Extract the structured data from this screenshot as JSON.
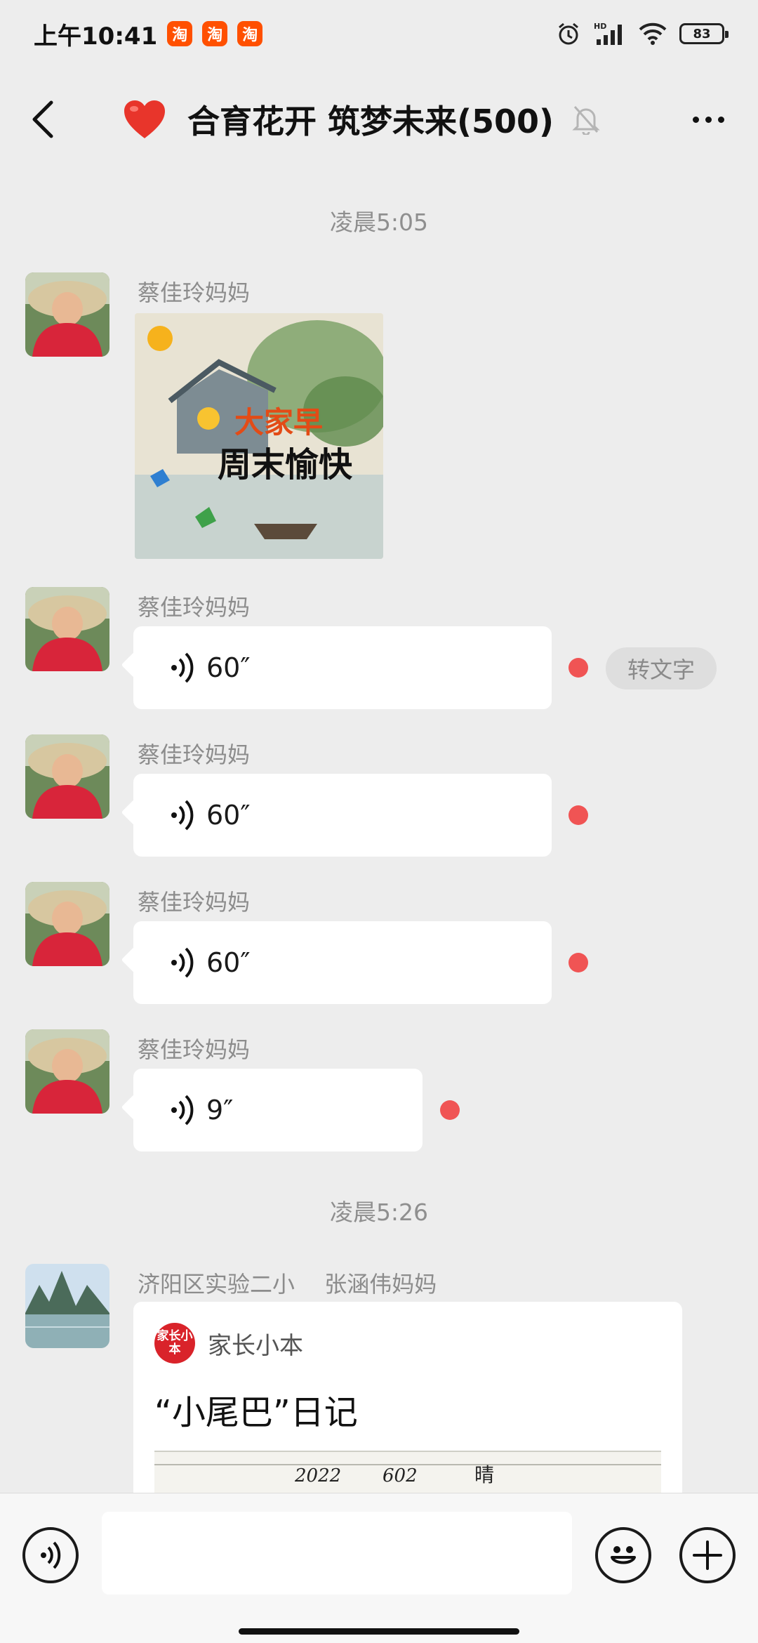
{
  "status_bar": {
    "time": "上午10:41",
    "app_badge": "淘",
    "network_label": "HD",
    "battery": "83"
  },
  "header": {
    "title": "合育花开 筑梦未来(500)",
    "back_icon": "chevron-left-icon",
    "mute_icon": "bell-off-icon",
    "more_icon": "more-dots-icon"
  },
  "messages": {
    "timestamp_1": "凌晨5:05",
    "timestamp_2": "凌晨5:26",
    "sender_1": "蔡佳玲妈妈",
    "sticker_text_line1": "大家早",
    "sticker_text_line2": "周末愉快",
    "voice_1_duration": "60″",
    "voice_2_duration": "60″",
    "voice_3_duration": "60″",
    "voice_4_duration": "9″",
    "to_text_label": "转文字",
    "sender_2_group": "济阳区实验二小",
    "sender_2_name": "张涵伟妈妈",
    "card": {
      "app_logo_text": "家长小本",
      "app_name": "家长小本",
      "title": "“小尾巴”日记",
      "thumb_text_year": "2022",
      "thumb_text_date": "602",
      "thumb_text_weather": "晴"
    }
  },
  "colors": {
    "background": "#ededed",
    "unread_dot": "#f05454",
    "heart": "#e8352b"
  },
  "input_bar": {
    "voice_icon": "voice-mode-icon",
    "emoji_icon": "emoji-icon",
    "plus_icon": "plus-icon",
    "input_value": ""
  }
}
